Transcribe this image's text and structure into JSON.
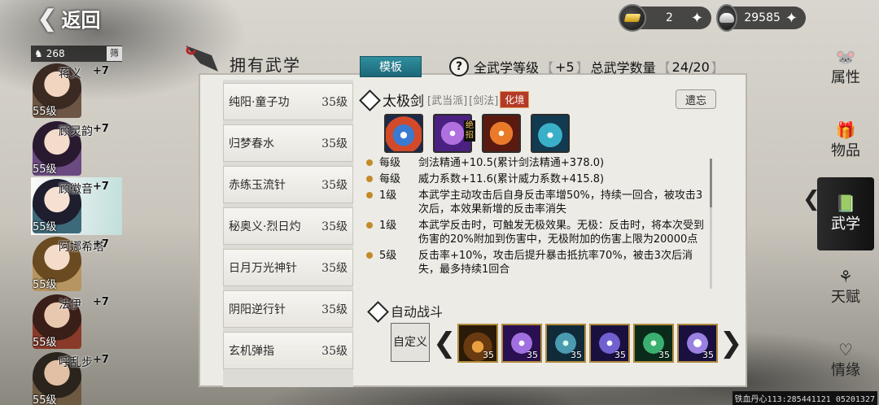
{
  "top": {
    "back_label": "返回",
    "gold": "2",
    "silver": "29585"
  },
  "characters": {
    "header_count": "268",
    "filter_label": "筛",
    "list": [
      {
        "name": "蒋义",
        "stars": "+7",
        "level": "55级"
      },
      {
        "name": "顾灵韵",
        "stars": "+7",
        "level": "55级"
      },
      {
        "name": "顾徽音",
        "stars": "+7",
        "level": "55级"
      },
      {
        "name": "阿娜希塔",
        "stars": "+7",
        "level": "55级"
      },
      {
        "name": "法伊",
        "stars": "+7",
        "level": "55级"
      },
      {
        "name": "呼乱步",
        "stars": "+7",
        "level": "55级"
      }
    ]
  },
  "panel": {
    "title": "拥有武学",
    "template_label": "模板",
    "all_level_label": "全武学等级",
    "all_level_value": "+5",
    "total_label": "总武学数量",
    "total_value": "24/20"
  },
  "skills": [
    {
      "name": "纯阳·童子功",
      "level": "35级"
    },
    {
      "name": "归梦春水",
      "level": "35级"
    },
    {
      "name": "赤练玉流针",
      "level": "35级"
    },
    {
      "name": "秘奥义·烈日灼",
      "level": "35级"
    },
    {
      "name": "日月万光神针",
      "level": "35级"
    },
    {
      "name": "阴阳逆行针",
      "level": "35级"
    },
    {
      "name": "玄机弹指",
      "level": "35级"
    }
  ],
  "detail": {
    "name": "太极剑",
    "sect": "[武当派]",
    "type": "[剑法]",
    "realm": "化境",
    "forget_label": "遗忘",
    "ultimate_badge": "绝招",
    "effects": [
      {
        "level": "每级",
        "text": "剑法精通+10.5(累计剑法精通+378.0)"
      },
      {
        "level": "每级",
        "text": "威力系数+11.6(累计威力系数+415.8)"
      },
      {
        "level": "1级",
        "text": "本武学主动攻击后自身反击率增50%，持续一回合，被攻击3次后，本效果新增的反击率消失"
      },
      {
        "level": "1级",
        "text": "本武学反击时，可触发无极效果。无极：反击时，将本次受到伤害的20%附加到伤害中，无极附加的伤害上限为20000点"
      },
      {
        "level": "5级",
        "text": "反击率+10%，攻击后提升暴击抵抗率70%，被击3次后消失，最多持续1回合"
      }
    ]
  },
  "auto_battle": {
    "title": "自动战斗",
    "custom_label": "自定义",
    "slots": [
      "35",
      "35",
      "35",
      "35",
      "35",
      "35"
    ]
  },
  "nav": [
    {
      "label": "属性",
      "icon": "mouse-icon"
    },
    {
      "label": "物品",
      "icon": "bag-icon"
    },
    {
      "label": "武学",
      "icon": "book-icon"
    },
    {
      "label": "天赋",
      "icon": "branch-icon"
    },
    {
      "label": "情缘",
      "icon": "heart-icon"
    }
  ],
  "footer": "铁血丹心113:285441121 05201327",
  "colors": {
    "accent_teal": "#2f8fa0",
    "realm_red": "#b33a25",
    "bullet_gold": "#c38a2a"
  }
}
